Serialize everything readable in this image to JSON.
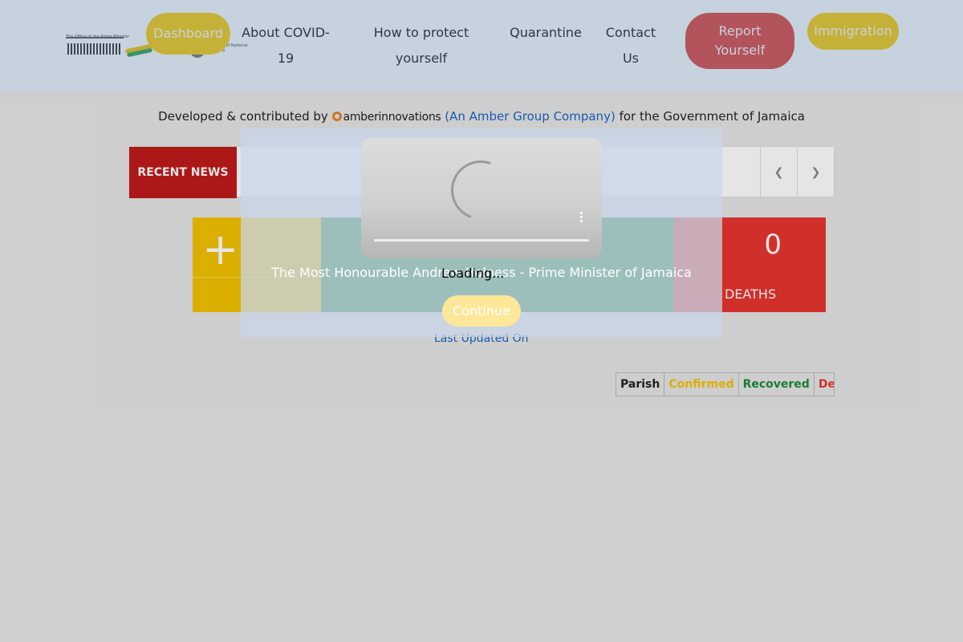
{
  "header": {
    "logos": {
      "opm_text": "The Office of the Prime Minister",
      "ministry_text": "Ministry of National Security"
    },
    "nav": {
      "dashboard": "Dashboard",
      "about_line1": "About COVID-",
      "about_line2": "19",
      "protect_line1": "How to protect",
      "protect_line2": "yourself",
      "quarantine": "Quarantine",
      "contact_line1": "Contact",
      "contact_line2": "Us",
      "report_line1": "Report",
      "report_line2": "Yourself",
      "immigration": "Immigration"
    }
  },
  "credit": {
    "prefix": "Developed & contributed by",
    "company_logo": "amberinnovations",
    "company_link": "(An Amber Group Company)",
    "suffix": "for the Government of Jamaica"
  },
  "news": {
    "label": "RECENT NEWS"
  },
  "stats": {
    "deaths_value": "0",
    "deaths_label": "DEATHS"
  },
  "last_updated": "Last Updated On",
  "table": {
    "headers": [
      "Parish",
      "Confirmed",
      "Recovered",
      "Dec"
    ]
  },
  "modal": {
    "video_caption": "The Most Honourable Andrew Holness - Prime Minister of Jamaica",
    "loading": "Loading...",
    "continue": "Continue"
  },
  "colors": {
    "yellow": "#ffcc00",
    "green": "#1e8a3a",
    "red": "#e8352f"
  }
}
